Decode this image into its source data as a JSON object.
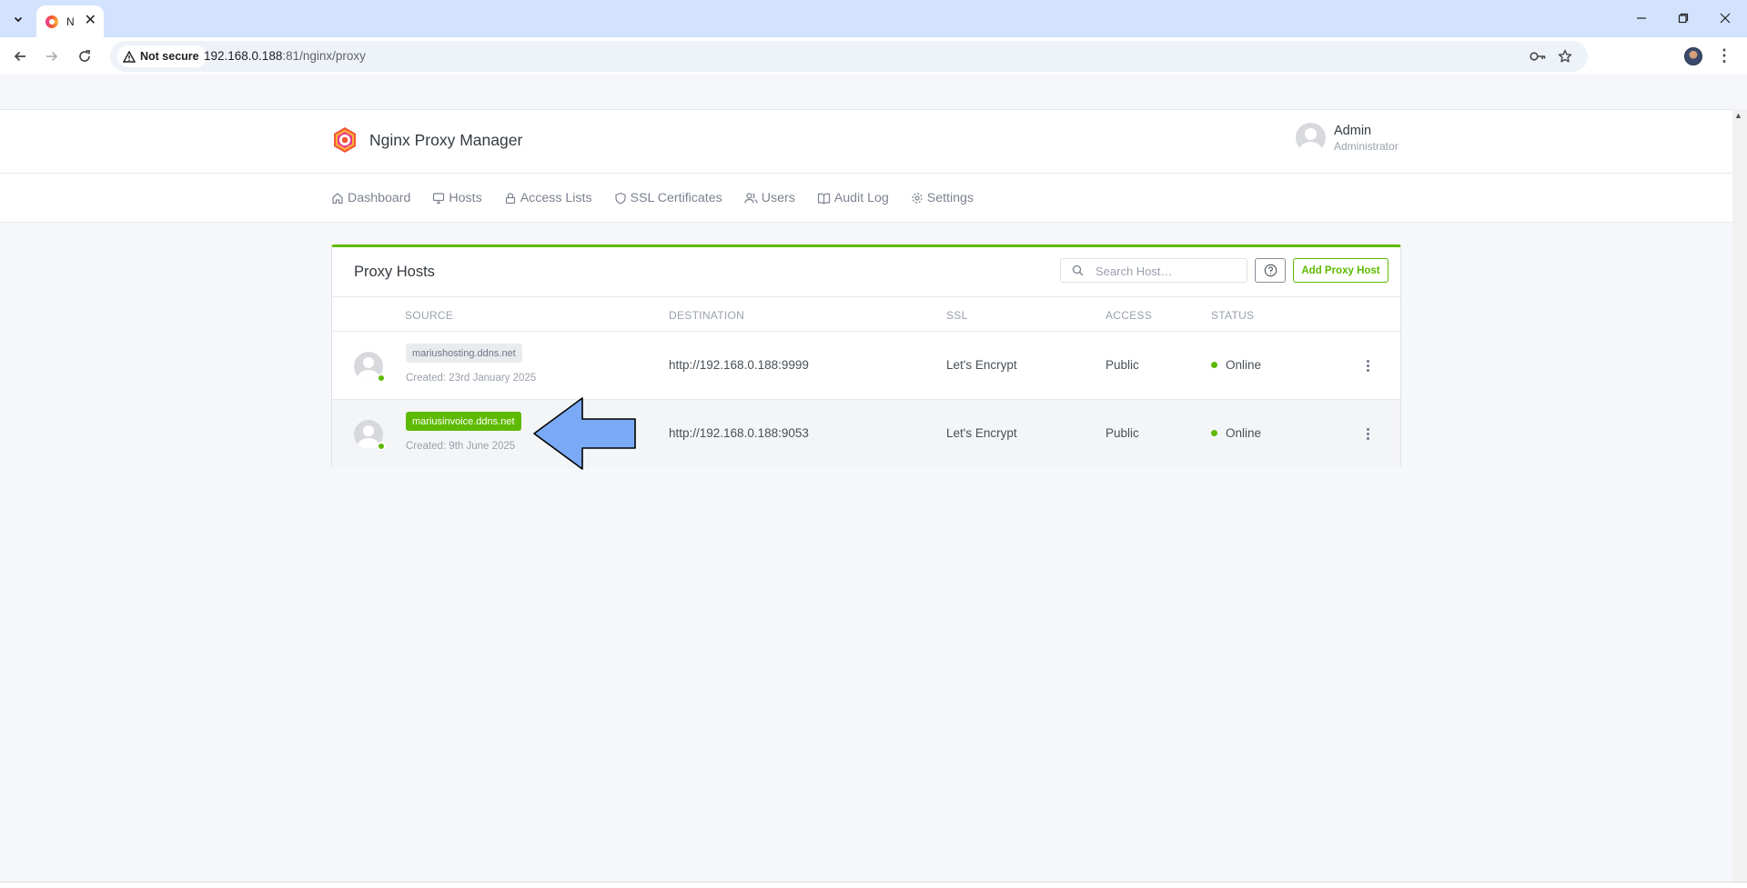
{
  "browser": {
    "tab_title": "N",
    "security_label": "Not secure",
    "url_host": "192.168.0.188",
    "url_rest": ":81/nginx/proxy"
  },
  "app": {
    "brand_title": "Nginx Proxy Manager",
    "user": {
      "name": "Admin",
      "role": "Administrator"
    },
    "nav": [
      {
        "label": "Dashboard",
        "icon": "home-icon"
      },
      {
        "label": "Hosts",
        "icon": "monitor-icon"
      },
      {
        "label": "Access Lists",
        "icon": "lock-icon"
      },
      {
        "label": "SSL Certificates",
        "icon": "shield-icon"
      },
      {
        "label": "Users",
        "icon": "users-icon"
      },
      {
        "label": "Audit Log",
        "icon": "book-icon"
      },
      {
        "label": "Settings",
        "icon": "settings-icon"
      }
    ]
  },
  "proxy_hosts": {
    "title": "Proxy Hosts",
    "search_placeholder": "Search Host…",
    "add_label": "Add Proxy Host",
    "columns": {
      "source": "SOURCE",
      "destination": "DESTINATION",
      "ssl": "SSL",
      "access": "ACCESS",
      "status": "STATUS"
    },
    "rows": [
      {
        "domain": "mariushosting.ddns.net",
        "created": "Created: 23rd January 2025",
        "destination": "http://192.168.0.188:9999",
        "ssl": "Let's Encrypt",
        "access": "Public",
        "status": "Online"
      },
      {
        "domain": "mariusinvoice.ddns.net",
        "created": "Created: 9th June 2025",
        "destination": "http://192.168.0.188:9053",
        "ssl": "Let's Encrypt",
        "access": "Public",
        "status": "Online"
      }
    ]
  },
  "colors": {
    "accent": "#5eba00",
    "annotation_arrow": "#7aaaf5"
  }
}
